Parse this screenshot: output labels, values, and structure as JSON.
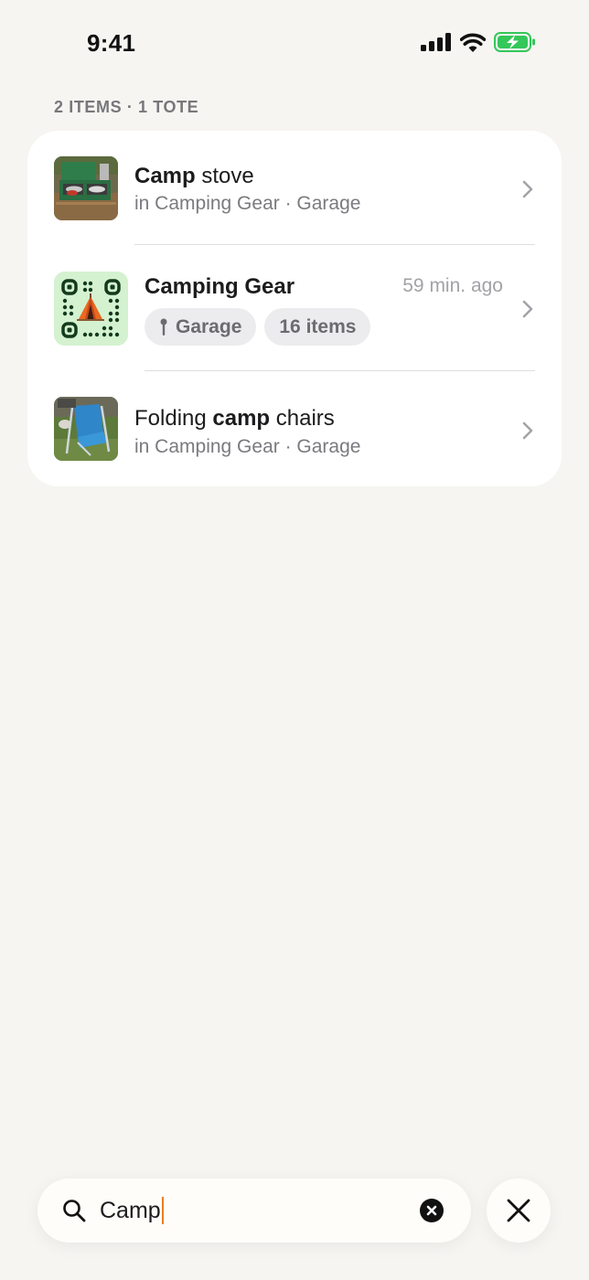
{
  "status_bar": {
    "time": "9:41",
    "icons": [
      "cellular-signal-icon",
      "wifi-icon",
      "battery-charging-icon"
    ],
    "battery_color": "#34c759"
  },
  "summary": "2 ITEMS · 1 TOTE",
  "results": [
    {
      "kind": "item",
      "title_bold": "Camp",
      "title_rest": " stove",
      "subtitle": "in Camping Gear · Garage",
      "thumbnail": "camp-stove-photo"
    },
    {
      "kind": "tote",
      "title": "Camping Gear",
      "time_ago": "59 min. ago",
      "location_chip": "Garage",
      "count_chip": "16 items",
      "icon": "tent-qr-code",
      "icon_bg": "#d4f1d0"
    },
    {
      "kind": "item",
      "title_prefix": "Folding ",
      "title_bold": "camp",
      "title_rest": " chairs",
      "subtitle": "in Camping Gear · Garage",
      "thumbnail": "camp-chair-photo"
    }
  ],
  "search": {
    "value": "Camp",
    "icon": "search-icon",
    "clear_icon": "clear-x-circle-icon",
    "caret_color": "#e67e22"
  },
  "close_icon": "close-icon"
}
